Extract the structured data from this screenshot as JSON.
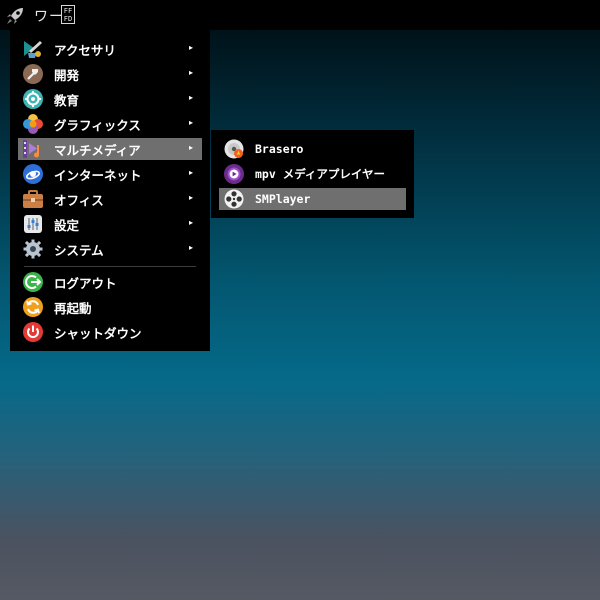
{
  "panel": {
    "launcher_icon": "rocket-icon",
    "workspace_label": "ワー",
    "hex_glyph_top": "FF",
    "hex_glyph_bottom": "FD"
  },
  "menu": {
    "arrow": "▸",
    "items": [
      {
        "label": "アクセサリ",
        "icon": "accessories-icon",
        "has_submenu": true
      },
      {
        "label": "開発",
        "icon": "development-icon",
        "has_submenu": true
      },
      {
        "label": "教育",
        "icon": "education-icon",
        "has_submenu": true
      },
      {
        "label": "グラフィックス",
        "icon": "graphics-icon",
        "has_submenu": true
      },
      {
        "label": "マルチメディア",
        "icon": "multimedia-icon",
        "has_submenu": true,
        "selected": true
      },
      {
        "label": "インターネット",
        "icon": "internet-icon",
        "has_submenu": true
      },
      {
        "label": "オフィス",
        "icon": "office-icon",
        "has_submenu": true
      },
      {
        "label": "設定",
        "icon": "settings-icon",
        "has_submenu": true
      },
      {
        "label": "システム",
        "icon": "system-icon",
        "has_submenu": true
      },
      {
        "label": "ログアウト",
        "icon": "logout-icon"
      },
      {
        "label": "再起動",
        "icon": "reboot-icon"
      },
      {
        "label": "シャットダウン",
        "icon": "shutdown-icon"
      }
    ]
  },
  "submenu": {
    "items": [
      {
        "label": "Brasero",
        "icon": "brasero-disc-icon"
      },
      {
        "label": "mpv メディアプレイヤー",
        "icon": "mpv-play-icon"
      },
      {
        "label": "SMPlayer",
        "icon": "smplayer-reel-icon",
        "selected": true
      }
    ]
  },
  "colors": {
    "menu_bg": "#000000",
    "selection_bg": "#6f6f6f",
    "desktop_top": "#000a0e",
    "desktop_mid": "#056a89",
    "desktop_bottom": "#555962"
  }
}
